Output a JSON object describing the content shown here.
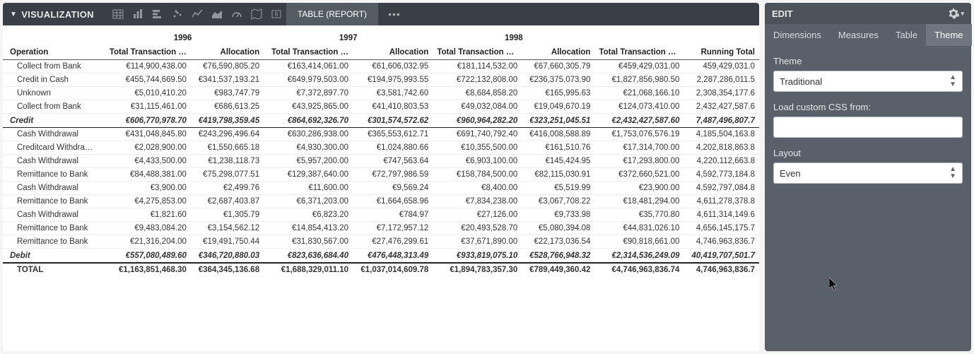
{
  "toolbar": {
    "title": "VISUALIZATION",
    "active_tab": "TABLE (REPORT)"
  },
  "edit_panel": {
    "title": "EDIT",
    "tabs": [
      "Dimensions",
      "Measures",
      "Table",
      "Theme"
    ],
    "active_tab": "Theme",
    "theme_label": "Theme",
    "theme_value": "Traditional",
    "css_label": "Load custom CSS from:",
    "css_value": "",
    "layout_label": "Layout",
    "layout_value": "Even"
  },
  "table": {
    "years": [
      "1996",
      "1997",
      "1998"
    ],
    "col_operation": "Operation",
    "col_ttv_a": "Total Transaction …",
    "col_ttv_b": "Total Transaction V…",
    "col_alloc": "Allocation",
    "col_running": "Running Total",
    "rows": [
      {
        "op": "Collect from Bank",
        "c": [
          "€114,900,438.00",
          "€76,590,805.20",
          "€163,414,061.00",
          "€61,606,032.95",
          "€181,114,532.00",
          "€67,660,305.79",
          "€459,429,031.00",
          "459,429,031.0"
        ]
      },
      {
        "op": "Credit in Cash",
        "c": [
          "€455,744,669.50",
          "€341,537,193.21",
          "€649,979,503.00",
          "€194,975,993.55",
          "€722,132,808.00",
          "€236,375,073.90",
          "€1,827,856,980.50",
          "2,287,286,011.5"
        ]
      },
      {
        "op": "Unknown",
        "c": [
          "€5,010,410.20",
          "€983,747.79",
          "€7,372,897.70",
          "€3,581,742.60",
          "€8,684,858.20",
          "€165,995.63",
          "€21,068,166.10",
          "2,308,354,177.6"
        ]
      },
      {
        "op": "Collect from Bank",
        "c": [
          "€31,115,461.00",
          "€686,613.25",
          "€43,925,865.00",
          "€41,410,803.53",
          "€49,032,084.00",
          "€19,049,670.19",
          "€124,073,410.00",
          "2,432,427,587.6"
        ]
      }
    ],
    "credit_row": {
      "op": "Credit",
      "c": [
        "€606,770,978.70",
        "€419,798,359.45",
        "€864,692,326.70",
        "€301,574,572.62",
        "€960,964,282.20",
        "€323,251,045.51",
        "€2,432,427,587.60",
        "7,487,496,807.7"
      ]
    },
    "debit_rows": [
      {
        "op": "Cash Withdrawal",
        "c": [
          "€431,048,845.80",
          "€243,296,496.64",
          "€630,286,938.00",
          "€365,553,612.71",
          "€691,740,792.40",
          "€416,008,588.89",
          "€1,753,076,576.19",
          "4,185,504,163.8"
        ]
      },
      {
        "op": "Creditcard Withdra…",
        "c": [
          "€2,028,900.00",
          "€1,550,665.18",
          "€4,930,300.00",
          "€1,024,880.66",
          "€10,355,500.00",
          "€161,510.76",
          "€17,314,700.00",
          "4,202,818,863.8"
        ]
      },
      {
        "op": "Cash Withdrawal",
        "c": [
          "€4,433,500.00",
          "€1,238,118.73",
          "€5,957,200.00",
          "€747,563.64",
          "€6,903,100.00",
          "€145,424.95",
          "€17,293,800.00",
          "4,220,112,663.8"
        ]
      },
      {
        "op": "Remittance to Bank",
        "c": [
          "€84,488,381.00",
          "€75,298,077.51",
          "€129,387,640.00",
          "€72,797,986.59",
          "€158,784,500.00",
          "€82,115,030.91",
          "€372,660,521.00",
          "4,592,773,184.8"
        ]
      },
      {
        "op": "Cash Withdrawal",
        "c": [
          "€3,900.00",
          "€2,499.76",
          "€11,600.00",
          "€9,569.24",
          "€8,400.00",
          "€5,519.99",
          "€23,900.00",
          "4,592,797,084.8"
        ]
      },
      {
        "op": "Remittance to Bank",
        "c": [
          "€4,275,853.00",
          "€2,687,403.87",
          "€6,371,203.00",
          "€1,664,658.96",
          "€7,834,238.00",
          "€3,067,708.22",
          "€18,481,294.00",
          "4,611,278,378.8"
        ]
      },
      {
        "op": "Cash Withdrawal",
        "c": [
          "€1,821.60",
          "€1,305.79",
          "€6,823.20",
          "€784.97",
          "€27,126.00",
          "€9,733.98",
          "€35,770.80",
          "4,611,314,149.6"
        ]
      },
      {
        "op": "Remittance to Bank",
        "c": [
          "€9,483,084.20",
          "€3,154,562.12",
          "€14,854,413.20",
          "€7,172,957.12",
          "€20,493,528.70",
          "€5,080,394.08",
          "€44,831,026.10",
          "4,656,145,175.7"
        ]
      },
      {
        "op": "Remittance to Bank",
        "c": [
          "€21,316,204.00",
          "€19,491,750.44",
          "€31,830,567.00",
          "€27,476,299.61",
          "€37,671,890.00",
          "€22,173,036.54",
          "€90,818,661.00",
          "4,746,963,836.7"
        ]
      }
    ],
    "debit_row": {
      "op": "Debit",
      "c": [
        "€557,080,489.60",
        "€346,720,880.03",
        "€823,636,684.40",
        "€476,448,313.49",
        "€933,819,075.10",
        "€528,766,948.32",
        "€2,314,536,249.09",
        "40,419,707,501.7"
      ]
    },
    "total_row": {
      "op": "TOTAL",
      "c": [
        "€1,163,851,468.30",
        "€364,345,136.68",
        "€1,688,329,011.10",
        "€1,037,014,609.78",
        "€1,894,783,357.30",
        "€789,449,360.42",
        "€4,746,963,836.74",
        "4,746,963,836.7"
      ]
    }
  }
}
